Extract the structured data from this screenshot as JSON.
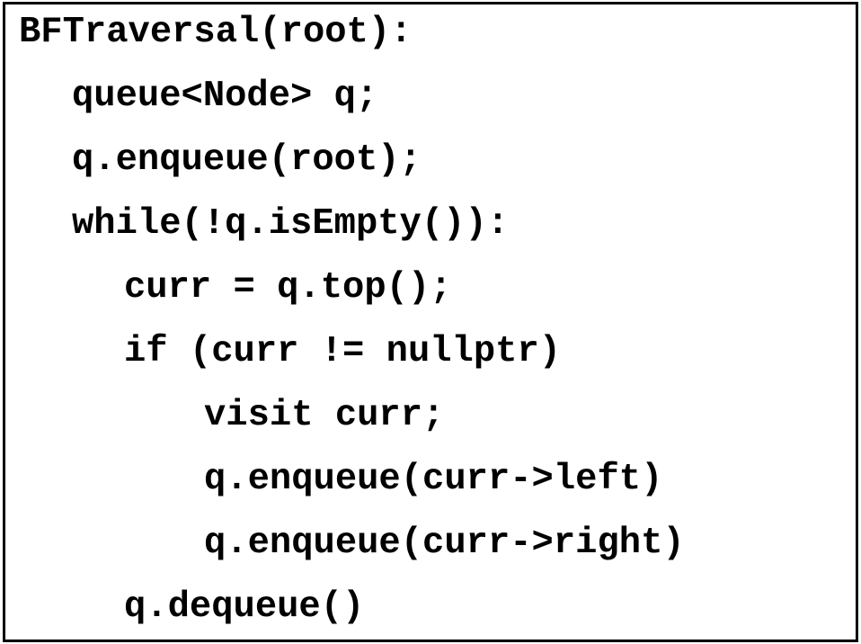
{
  "code": {
    "lines": [
      {
        "text": "BFTraversal(root):",
        "indent": 0
      },
      {
        "text": "queue<Node> q;",
        "indent": 1
      },
      {
        "text": "q.enqueue(root);",
        "indent": 1
      },
      {
        "text": "while(!q.isEmpty()):",
        "indent": 1
      },
      {
        "text": "curr = q.top();",
        "indent": 2
      },
      {
        "text": "if (curr != nullptr)",
        "indent": 2
      },
      {
        "text": "visit curr;",
        "indent": 3
      },
      {
        "text": "q.enqueue(curr->left)",
        "indent": 3
      },
      {
        "text": "q.enqueue(curr->right)",
        "indent": 3
      },
      {
        "text": "q.dequeue()",
        "indent": 2
      }
    ]
  },
  "colors": {
    "text": "#000000",
    "border": "#000000",
    "background": "#ffffff"
  }
}
